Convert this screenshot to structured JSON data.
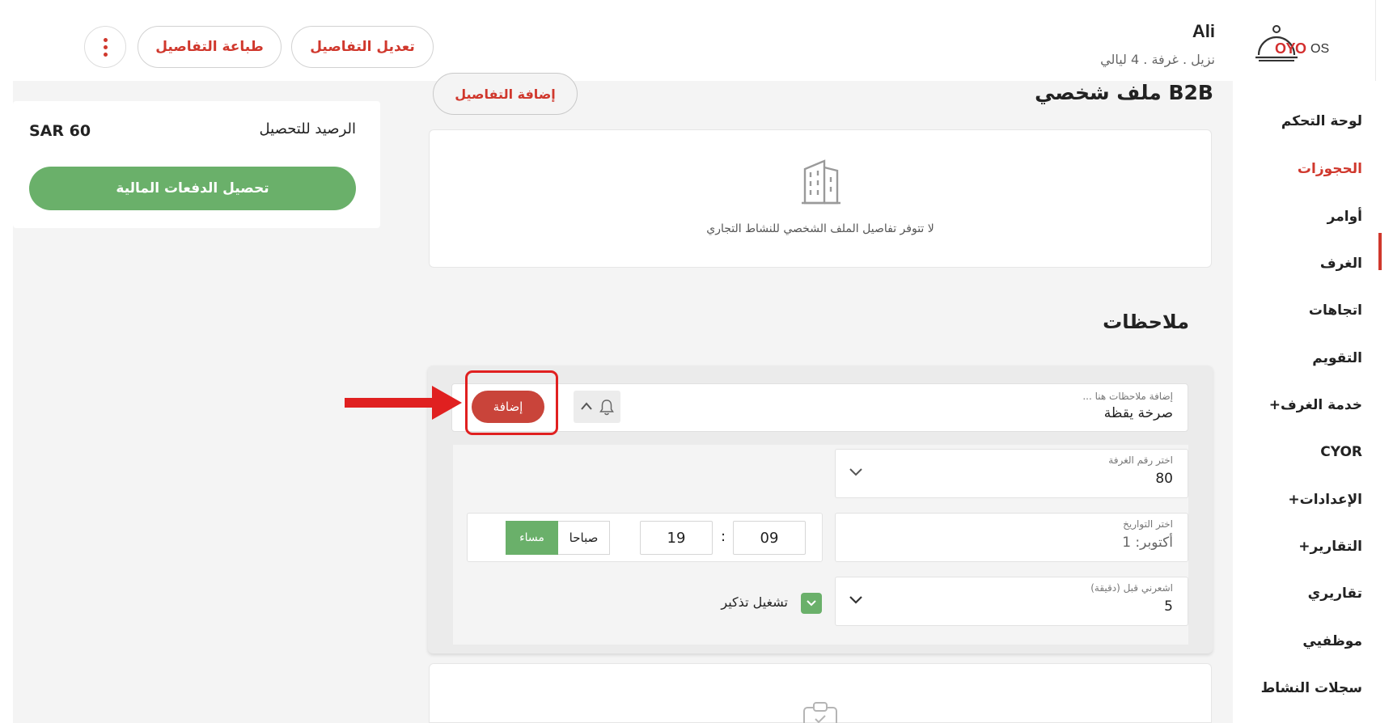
{
  "header": {
    "logo_text": "OYO",
    "logo_suffix": "OS",
    "user_name": "Ali",
    "stay_summary": "نزيل . غرفة . 4 ليالي",
    "edit_details_label": "تعديل التفاصيل",
    "print_details_label": "طباعة التفاصيل"
  },
  "sidebar": {
    "items": [
      {
        "label": "لوحة التحكم"
      },
      {
        "label": "الحجوزات"
      },
      {
        "label": "أوامر"
      },
      {
        "label": "الغرف"
      },
      {
        "label": "اتجاهات"
      },
      {
        "label": "التقويم"
      },
      {
        "label": "خدمة الغرف+"
      },
      {
        "label": "CYOR"
      },
      {
        "label": "الإعدادات+"
      },
      {
        "label": "التقارير+"
      },
      {
        "label": "تقاريري"
      },
      {
        "label": "موظفيي"
      },
      {
        "label": "سجلات النشاط"
      }
    ],
    "active_index": 1
  },
  "balance": {
    "label": "الرصيد للتحصيل",
    "value": "SAR 60",
    "collect_button_label": "تحصيل الدفعات المالية"
  },
  "b2b": {
    "title": "B2B ملف شخصي",
    "add_details_label": "إضافة التفاصيل",
    "empty_message": "لا تتوفر تفاصيل الملف الشخصي للنشاط التجاري"
  },
  "notes": {
    "title": "ملاحظات",
    "input_placeholder": "إضافة ملاحظات هنا ...",
    "input_value": "صرخة يقظة",
    "add_button_label": "إضافة",
    "room_select": {
      "label": "اختر رقم الغرفة",
      "value": "80"
    },
    "date_picker": {
      "label": "اختر التواريخ",
      "value": "أكتوبر: 1"
    },
    "time": {
      "hour": "09",
      "minute": "19",
      "am_label": "صباحا",
      "pm_label": "مساء",
      "selected": "pm"
    },
    "notify_before": {
      "label": "اشعرني قبل (دقيقة)",
      "value": "5"
    },
    "reminder_checkbox_label": "تشغيل تذكير",
    "reminder_checked": true
  },
  "colors": {
    "brand_red": "#d0382d",
    "accent_green": "#6ab06a",
    "highlight_red": "#e02020"
  }
}
